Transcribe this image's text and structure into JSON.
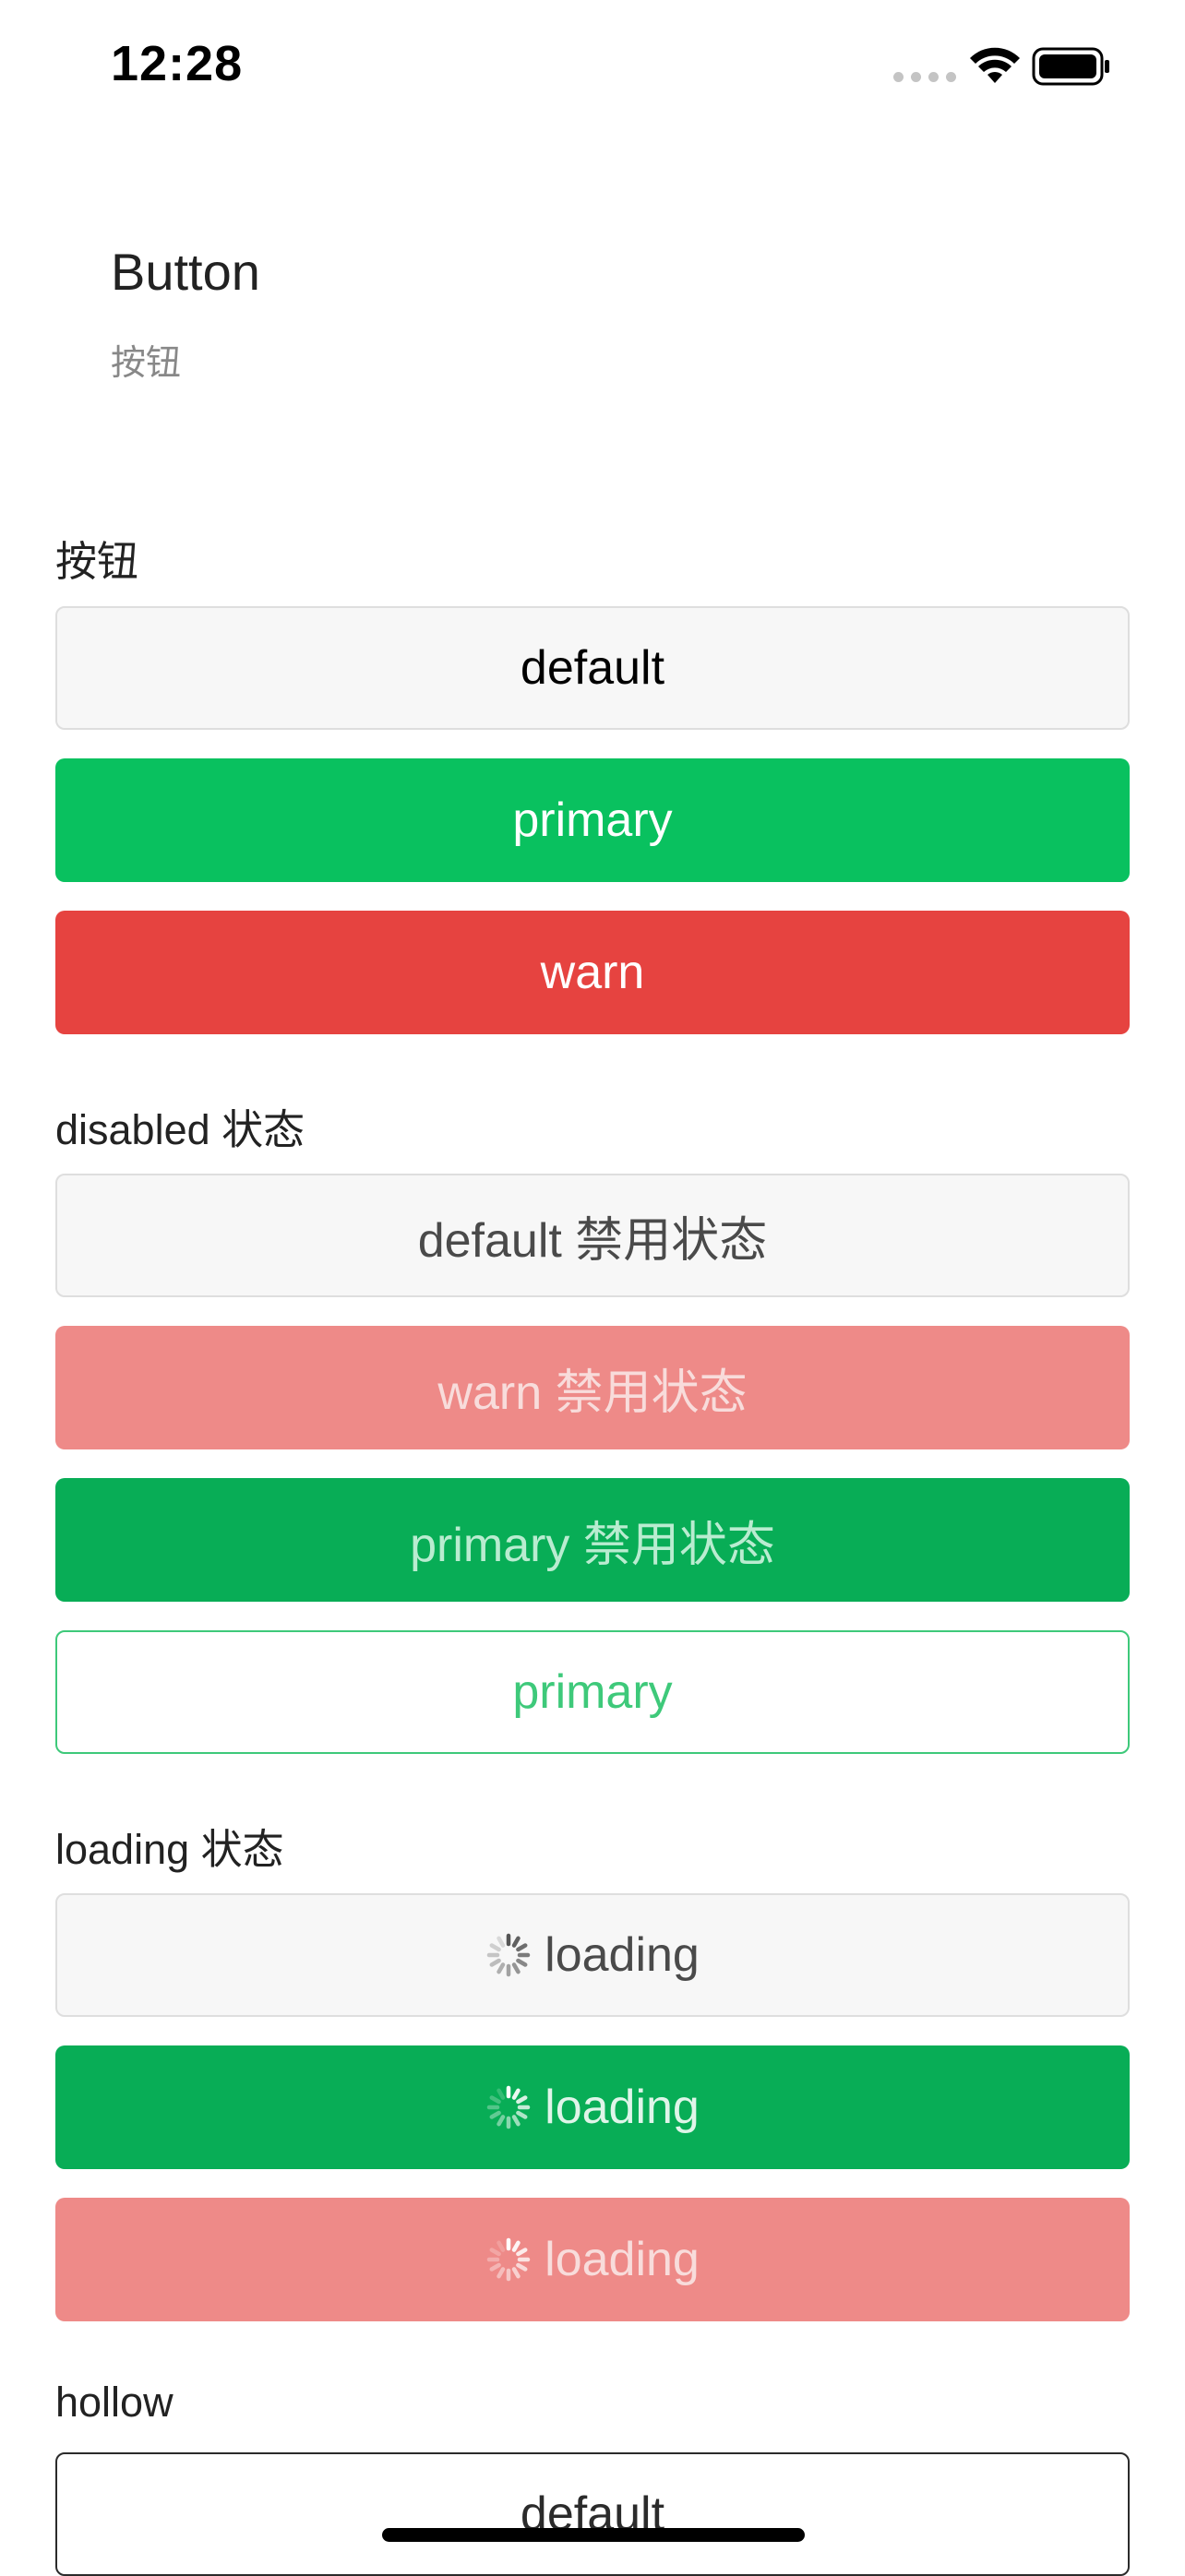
{
  "status_bar": {
    "time": "12:28"
  },
  "header": {
    "title": "Button",
    "subtitle": "按钮"
  },
  "sections": {
    "basic": {
      "label": "按钮",
      "default": "default",
      "primary": "primary",
      "warn": "warn"
    },
    "disabled": {
      "label": "disabled 状态",
      "default": "default 禁用状态",
      "warn": "warn 禁用状态",
      "primary": "primary 禁用状态",
      "primary_plain": "primary"
    },
    "loading": {
      "label": "loading 状态",
      "default": "loading",
      "primary": "loading",
      "warn": "loading"
    },
    "hollow": {
      "label": "hollow",
      "default": "default"
    }
  },
  "colors": {
    "primary": "#09c15f",
    "warn": "#e64340",
    "default_bg": "#f7f7f7"
  }
}
